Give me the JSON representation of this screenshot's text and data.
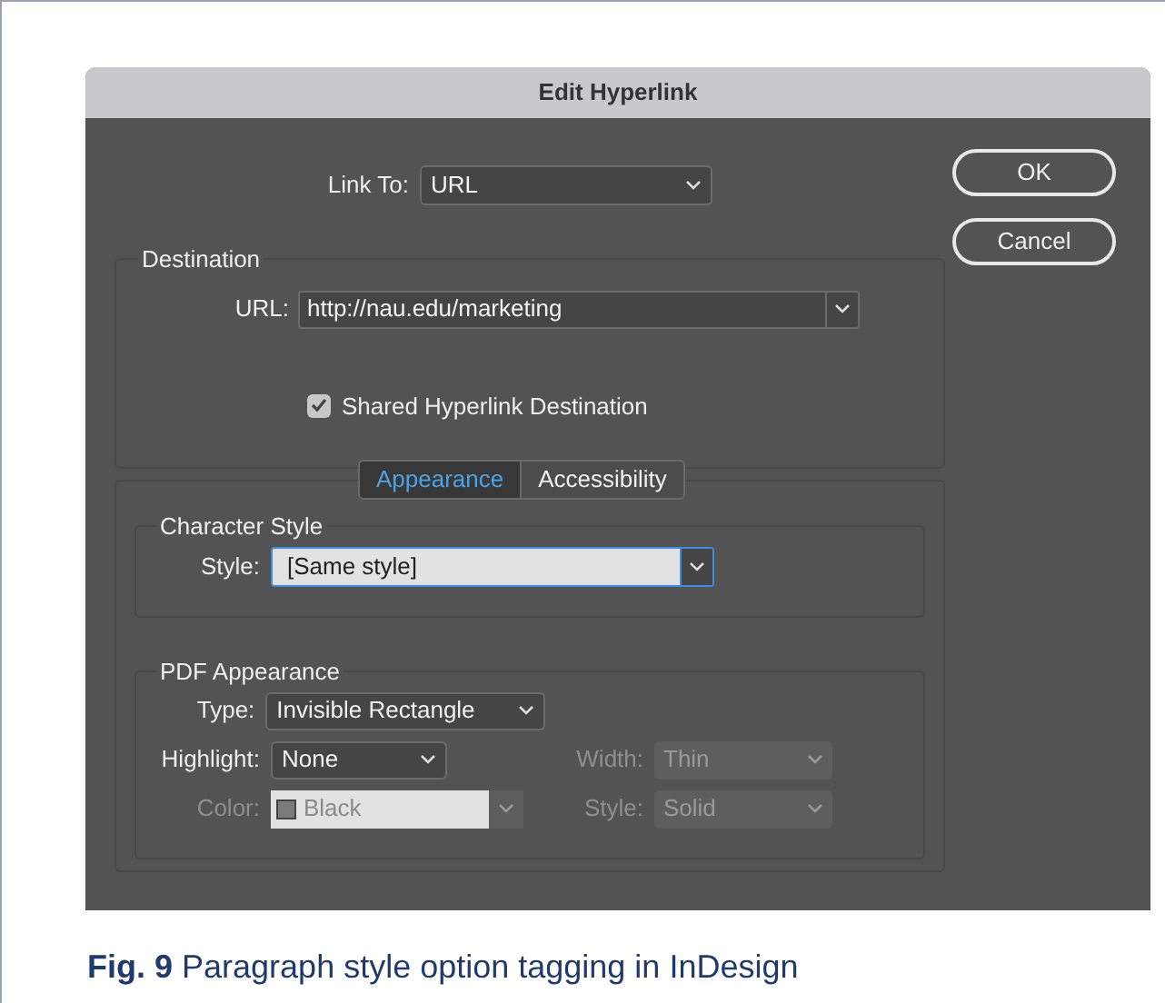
{
  "window": {
    "title": "Edit Hyperlink"
  },
  "link_to": {
    "label": "Link To:",
    "value": "URL"
  },
  "buttons": [
    {
      "label": "OK"
    },
    {
      "label": "Cancel"
    }
  ],
  "destination": {
    "legend": "Destination",
    "url": {
      "label": "URL:",
      "value": "http://nau.edu/marketing"
    },
    "shared": {
      "label": "Shared Hyperlink Destination",
      "checked": true
    }
  },
  "tabs": [
    {
      "label": "Appearance",
      "selected": true
    },
    {
      "label": "Accessibility",
      "selected": false
    }
  ],
  "character_style": {
    "legend": "Character Style",
    "style": {
      "label": "Style:",
      "value": "[Same style]",
      "focused": true
    }
  },
  "pdf_appearance": {
    "legend": "PDF Appearance",
    "rows": [
      [
        {
          "kind": "select",
          "label": "Type:",
          "value": "Invisible Rectangle",
          "disabled": false
        }
      ],
      [
        {
          "kind": "select",
          "label": "Highlight:",
          "value": "None",
          "disabled": false
        },
        {
          "kind": "select",
          "label": "Width:",
          "value": "Thin",
          "disabled": true
        }
      ],
      [
        {
          "kind": "color",
          "label": "Color:",
          "value": "Black",
          "disabled": true
        },
        {
          "kind": "select",
          "label": "Style:",
          "value": "Solid",
          "disabled": true
        }
      ]
    ]
  },
  "caption": "**Fig. 9** Paragraph style option tagging in InDesign"
}
